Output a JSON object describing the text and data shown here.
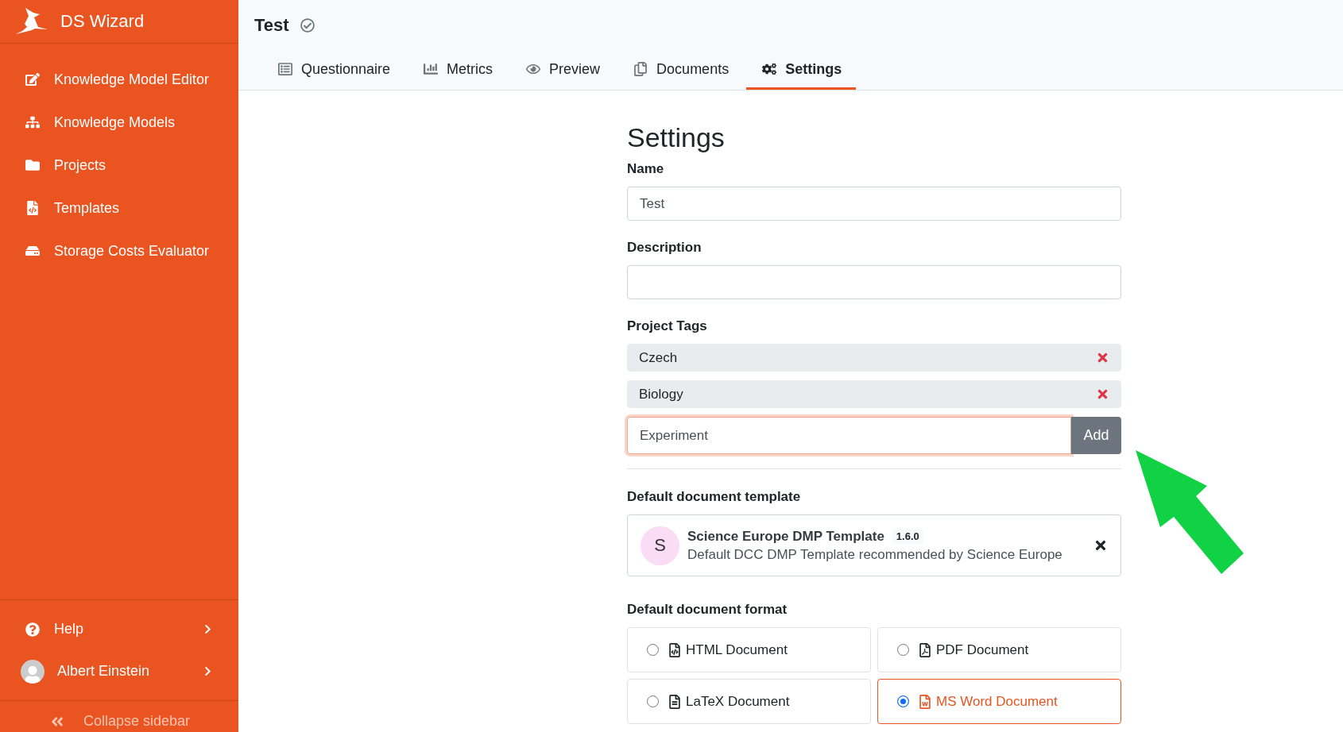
{
  "sidebar": {
    "brand": "DS Wizard",
    "items": [
      {
        "label": "Knowledge Model Editor"
      },
      {
        "label": "Knowledge Models"
      },
      {
        "label": "Projects"
      },
      {
        "label": "Templates"
      },
      {
        "label": "Storage Costs Evaluator"
      }
    ],
    "help": "Help",
    "user": "Albert Einstein",
    "collapse": "Collapse sidebar"
  },
  "header": {
    "title": "Test",
    "tabs": [
      {
        "label": "Questionnaire",
        "selected": false
      },
      {
        "label": "Metrics",
        "selected": false
      },
      {
        "label": "Preview",
        "selected": false
      },
      {
        "label": "Documents",
        "selected": false
      },
      {
        "label": "Settings",
        "selected": true
      }
    ]
  },
  "settings": {
    "heading": "Settings",
    "fields": [
      {
        "label": "Name",
        "value": "Test"
      },
      {
        "label": "Description"
      }
    ],
    "tags": {
      "label": "Project Tags",
      "items": [
        "Czech",
        "Biology"
      ],
      "new_tag": "Experiment",
      "add": "Add"
    },
    "template": {
      "label": "Default document template",
      "initial": "S",
      "name": "Science Europe DMP Template",
      "version": "1.6.0",
      "description": "Default DCC DMP Template recommended by Science Europe"
    },
    "format": {
      "label": "Default document format",
      "options": [
        {
          "label": "HTML Document",
          "selected": false
        },
        {
          "label": "PDF Document",
          "selected": false
        },
        {
          "label": "LaTeX Document",
          "selected": false
        },
        {
          "label": "MS Word Document",
          "selected": true
        }
      ]
    }
  }
}
